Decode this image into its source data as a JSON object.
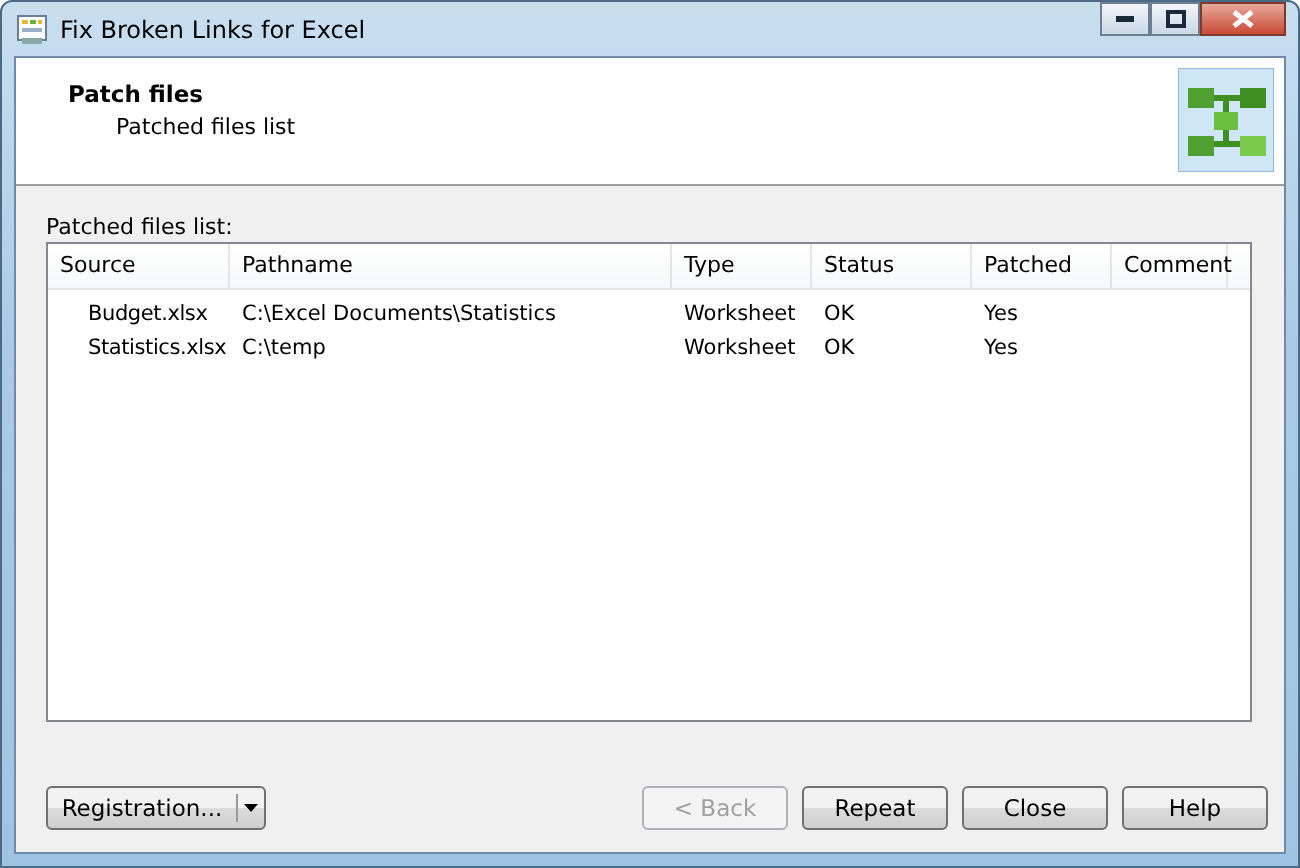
{
  "window": {
    "title": "Fix Broken Links for Excel"
  },
  "header": {
    "title": "Patch files",
    "subtitle": "Patched files list"
  },
  "list": {
    "label": "Patched files list:",
    "columns": [
      "Source",
      "Pathname",
      "Type",
      "Status",
      "Patched",
      "Comment"
    ],
    "rows": [
      [
        "Budget.xlsx",
        "C:\\Excel Documents\\Statistics",
        "Worksheet",
        "OK",
        "Yes",
        ""
      ],
      [
        "Statistics.xlsx",
        "C:\\temp",
        "Worksheet",
        "OK",
        "Yes",
        ""
      ]
    ]
  },
  "buttons": [
    {
      "kind": "split",
      "label": "Registration...",
      "disabled": false
    },
    {
      "kind": "push",
      "label": "< Back",
      "disabled": true
    },
    {
      "kind": "push",
      "label": "Repeat",
      "disabled": false
    },
    {
      "kind": "push",
      "label": "Close",
      "disabled": false
    },
    {
      "kind": "push",
      "label": "Help",
      "disabled": false
    }
  ]
}
